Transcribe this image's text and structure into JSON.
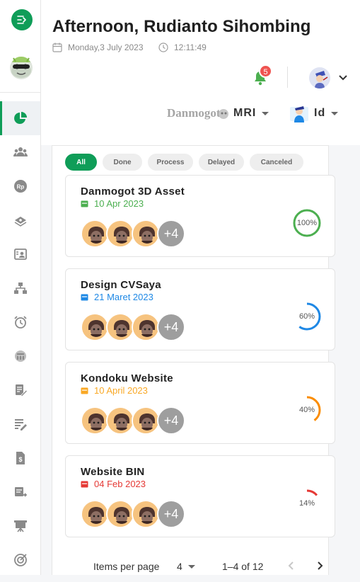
{
  "sidebar": {
    "items": [
      {
        "name": "sidebar-item-dashboard",
        "icon": "pie-chart-icon",
        "active": true
      },
      {
        "name": "sidebar-item-team",
        "icon": "group-icon",
        "active": false
      },
      {
        "name": "sidebar-item-payroll",
        "icon": "rupiah-icon",
        "active": false
      },
      {
        "name": "sidebar-item-money",
        "icon": "money-icon",
        "active": false
      },
      {
        "name": "sidebar-item-employee",
        "icon": "person-card-icon",
        "active": false
      },
      {
        "name": "sidebar-item-organization",
        "icon": "org-chart-icon",
        "active": false
      },
      {
        "name": "sidebar-item-attendance",
        "icon": "alarm-icon",
        "active": false
      },
      {
        "name": "sidebar-item-calendar",
        "icon": "calendar-icon",
        "active": false
      },
      {
        "name": "sidebar-item-tasks",
        "icon": "edit-note-icon",
        "active": false
      },
      {
        "name": "sidebar-item-reports",
        "icon": "list-edit-icon",
        "active": false
      },
      {
        "name": "sidebar-item-invoice",
        "icon": "dollar-file-icon",
        "active": false
      },
      {
        "name": "sidebar-item-transfer",
        "icon": "transfer-doc-icon",
        "active": false
      },
      {
        "name": "sidebar-item-presentation",
        "icon": "presentation-icon",
        "active": false
      },
      {
        "name": "sidebar-item-goals",
        "icon": "target-icon",
        "active": false
      }
    ]
  },
  "header": {
    "greeting": "Afternoon, Rudianto Sihombing",
    "date": "Monday,3 July 2023",
    "time": "12:11:49",
    "notification_count": "5",
    "brand_text": "Danmogot",
    "company": "MRI",
    "language": "Id"
  },
  "filters": [
    {
      "label": "All",
      "active": true
    },
    {
      "label": "Done",
      "active": false
    },
    {
      "label": "Process",
      "active": false
    },
    {
      "label": "Delayed",
      "active": false
    },
    {
      "label": "Canceled",
      "active": false
    }
  ],
  "projects": [
    {
      "title": "Danmogot 3D Asset",
      "date": "10 Apr 2023",
      "date_color": "#4caf50",
      "more": "+4",
      "progress": 100,
      "progress_label": "100%",
      "ring_color": "#4caf50"
    },
    {
      "title": "Design CVSaya",
      "date": "21 Maret 2023",
      "date_color": "#1e88e5",
      "more": "+4",
      "progress": 60,
      "progress_label": "60%",
      "ring_color": "#1e88e5"
    },
    {
      "title": "Kondoku Website",
      "date": "10 April 2023",
      "date_color": "#f9a825",
      "more": "+4",
      "progress": 40,
      "progress_label": "40%",
      "ring_color": "#fb8c00"
    },
    {
      "title": "Website BIN",
      "date": "04 Feb 2023",
      "date_color": "#e53935",
      "more": "+4",
      "progress": 14,
      "progress_label": "14%",
      "ring_color": "#e53935"
    }
  ],
  "pagination": {
    "items_per_page_label": "Items per page",
    "items_per_page_value": "4",
    "range": "1–4 of 12"
  },
  "colors": {
    "accent": "#0f9d58"
  }
}
